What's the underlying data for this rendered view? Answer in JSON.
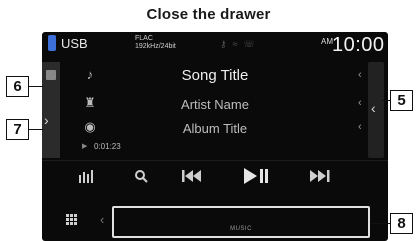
{
  "heading": "Close the drawer",
  "status": {
    "source": "USB",
    "format_line1": "FLAC",
    "format_line2": "192kHz/24bit",
    "ampm": "AM",
    "clock": "10:00"
  },
  "track": {
    "title": "Song Title",
    "artist": "Artist Name",
    "album": "Album Title",
    "elapsed": "0:01:23"
  },
  "drawer": {
    "label": "MUSIC"
  },
  "callouts": {
    "c6": "6",
    "c7": "7",
    "c5": "5",
    "c8": "8"
  },
  "icons": {
    "title": "note-icon",
    "artist": "person-icon",
    "album": "disc-icon",
    "eq": "equalizer-icon",
    "search": "search-icon",
    "prev": "previous-icon",
    "playpause": "play-pause-icon",
    "next": "next-icon",
    "menu": "grid-menu-icon"
  }
}
